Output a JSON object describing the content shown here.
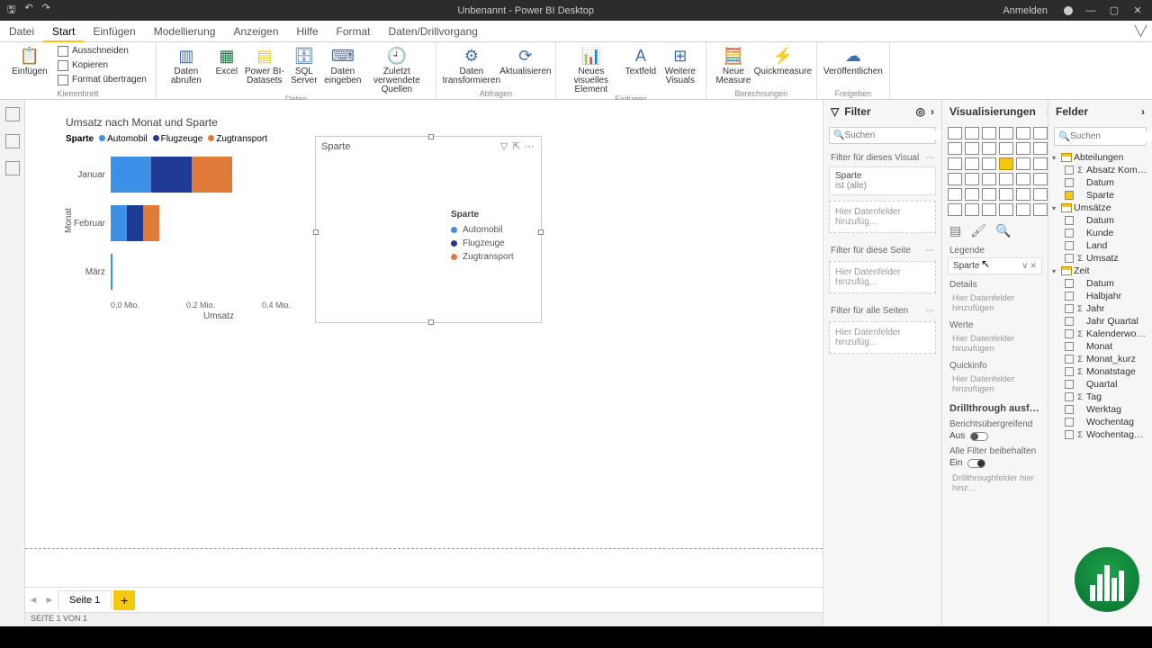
{
  "titlebar": {
    "title": "Unbenannt - Power BI Desktop",
    "signin": "Anmelden"
  },
  "ribbon_tabs": [
    "Datei",
    "Start",
    "Einfügen",
    "Modellierung",
    "Anzeigen",
    "Hilfe",
    "Format",
    "Daten/Drillvorgang"
  ],
  "ribbon": {
    "clipboard": {
      "paste": "Einfügen",
      "cut": "Ausschneiden",
      "copy": "Kopieren",
      "format_painter": "Format übertragen",
      "group": "Klemmbrett"
    },
    "data": {
      "get": "Daten abrufen",
      "excel": "Excel",
      "pbi": "Power BI-Datasets",
      "sql": "SQL Server",
      "enter": "Daten eingeben",
      "recent": "Zuletzt verwendete Quellen",
      "group": "Daten"
    },
    "queries": {
      "transform": "Daten transformieren",
      "refresh": "Aktualisieren",
      "group": "Abfragen"
    },
    "insert": {
      "new_visual": "Neues visuelles Element",
      "textbox": "Textfeld",
      "more": "Weitere Visuals",
      "group": "Einfügen"
    },
    "calc": {
      "new_measure": "Neue Measure",
      "quick": "Quickmeasure",
      "group": "Berechnungen"
    },
    "share": {
      "publish": "Veröffentlichen",
      "group": "Freigeben"
    }
  },
  "chart_data": {
    "type": "bar",
    "orientation": "horizontal",
    "stacked": true,
    "title": "Umsatz nach Monat und Sparte",
    "legend_title": "Sparte",
    "categories": [
      "Januar",
      "Februar",
      "März"
    ],
    "series": [
      {
        "name": "Automobil",
        "color": "#3c91e6",
        "values": [
          0.1,
          0.04,
          0.005
        ]
      },
      {
        "name": "Flugzeuge",
        "color": "#1f3a93",
        "values": [
          0.1,
          0.04,
          0.0
        ]
      },
      {
        "name": "Zugtransport",
        "color": "#e07b39",
        "values": [
          0.1,
          0.04,
          0.0
        ]
      }
    ],
    "xlabel": "Umsatz",
    "ylabel": "Monat",
    "xticks": [
      "0,0 Mio.",
      "0,2 Mio.",
      "0,4 Mio."
    ],
    "xlim": [
      0,
      0.4
    ]
  },
  "slicer": {
    "title": "Sparte",
    "legend_title": "Sparte",
    "items": [
      "Automobil",
      "Flugzeuge",
      "Zugtransport"
    ]
  },
  "filter_pane": {
    "title": "Filter",
    "search": "Suchen",
    "visual_section": "Filter für dieses Visual",
    "visual_card_field": "Sparte",
    "visual_card_state": "ist (alle)",
    "drop": "Hier Datenfelder hinzufüg…",
    "page_section": "Filter für diese Seite",
    "all_section": "Filter für alle Seiten"
  },
  "viz_pane": {
    "title": "Visualisierungen",
    "legend": "Legende",
    "legend_field": "Sparte",
    "details": "Details",
    "values": "Werte",
    "tooltip": "Quickinfo",
    "placeholder": "Hier Datenfelder hinzufügen",
    "drill_title": "Drillthrough ausf…",
    "cross": "Berichtsübergreifend",
    "cross_state": "Aus",
    "keep": "Alle Filter beibehalten",
    "keep_state": "Ein",
    "drill_drop": "Drillthroughfelder hier hinz…"
  },
  "fields_pane": {
    "title": "Felder",
    "search": "Suchen",
    "tables": [
      {
        "name": "Abteilungen",
        "expanded": true,
        "fields": [
          {
            "name": "Absatz Kom…",
            "sigma": true
          },
          {
            "name": "Datum"
          },
          {
            "name": "Sparte",
            "checked": true
          }
        ]
      },
      {
        "name": "Umsätze",
        "expanded": true,
        "fields": [
          {
            "name": "Datum"
          },
          {
            "name": "Kunde"
          },
          {
            "name": "Land"
          },
          {
            "name": "Umsatz",
            "sigma": true
          }
        ]
      },
      {
        "name": "Zeit",
        "expanded": true,
        "date_hierarchy": true,
        "fields": [
          {
            "name": "Datum"
          },
          {
            "name": "Halbjahr"
          },
          {
            "name": "Jahr",
            "sigma": true
          },
          {
            "name": "Jahr Quartal"
          },
          {
            "name": "Kalenderwo…",
            "sigma": true
          },
          {
            "name": "Monat"
          },
          {
            "name": "Monat_kurz",
            "sigma": true
          },
          {
            "name": "Monatstage",
            "sigma": true
          },
          {
            "name": "Quartal"
          },
          {
            "name": "Tag",
            "sigma": true
          },
          {
            "name": "Werktag"
          },
          {
            "name": "Wochentag"
          },
          {
            "name": "Wochentag…",
            "sigma": true
          }
        ]
      }
    ]
  },
  "page_tabs": {
    "page": "Seite 1"
  },
  "statusbar": "SEITE 1 VON 1"
}
